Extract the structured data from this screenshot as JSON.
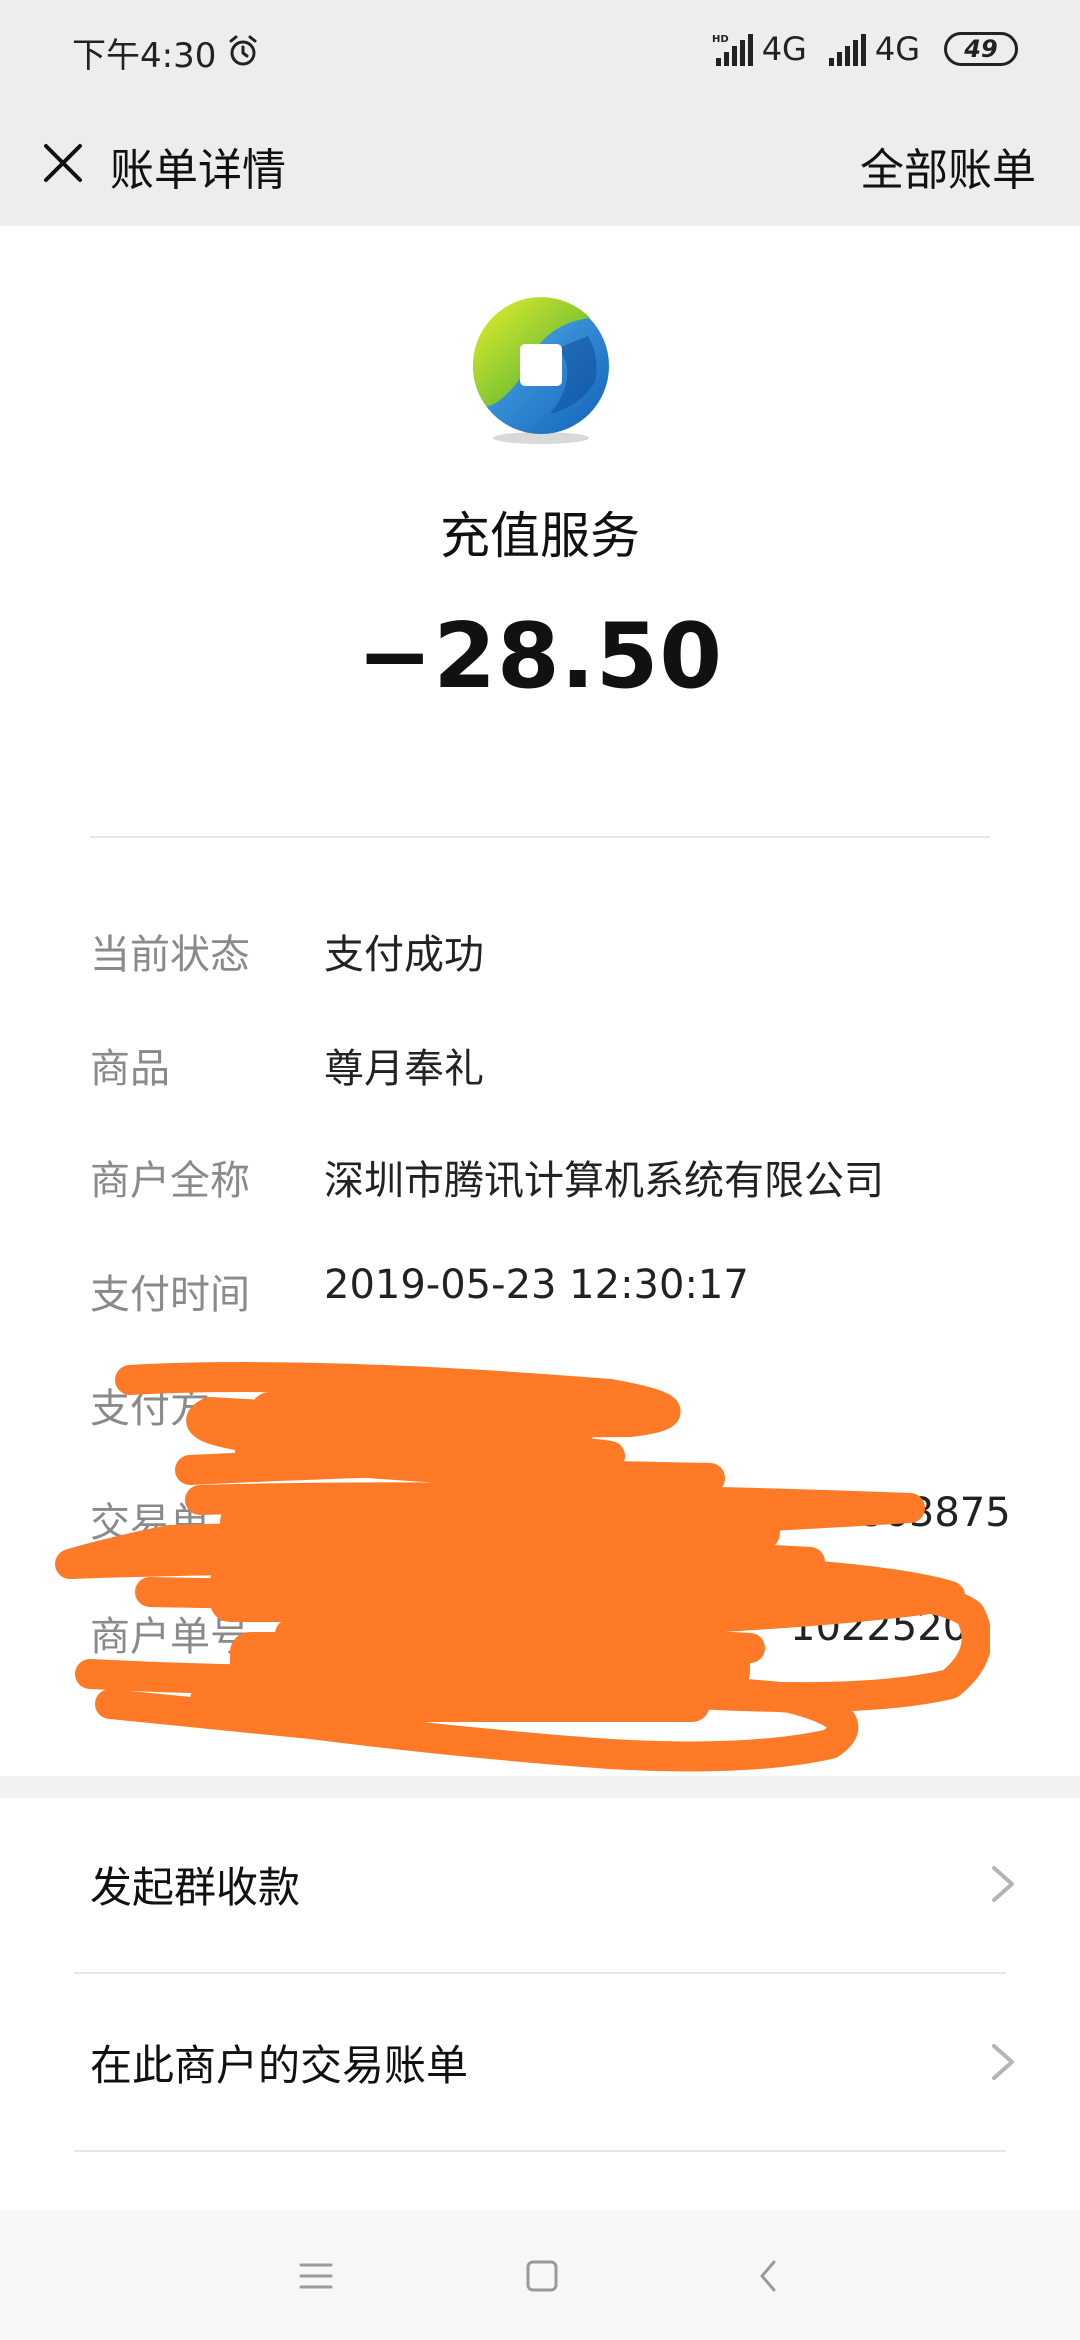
{
  "status_bar": {
    "time": "下午4:30",
    "network_1": "4G",
    "network_2": "4G",
    "battery": "49",
    "icons": [
      "alarm-icon",
      "hd-signal-icon",
      "signal-icon",
      "battery-icon"
    ]
  },
  "header": {
    "title": "账单详情",
    "right_action": "全部账单",
    "close_icon": "close-icon"
  },
  "merchant": {
    "name": "充值服务",
    "amount": "−28.50",
    "logo_icon": "tenpay-logo-icon"
  },
  "details": [
    {
      "label": "当前状态",
      "value": "支付成功"
    },
    {
      "label": "商品",
      "value": "尊月奉礼"
    },
    {
      "label": "商户全称",
      "value": "深圳市腾讯计算机系统有限公司"
    },
    {
      "label": "支付时间",
      "value": "2019-05-23 12:30:17"
    }
  ],
  "redacted_fragments": {
    "row5_label": "支付方",
    "row5_value": ")",
    "row6_label": "交易单",
    "row6_value": "863875",
    "row7_label": "商户单号",
    "row7_value": "1022520"
  },
  "actions": [
    {
      "label": "发起群收款",
      "icon": "chevron-right-icon"
    },
    {
      "label": "在此商户的交易账单",
      "icon": "chevron-right-icon"
    }
  ],
  "system_nav": {
    "icons": [
      "menu-icon",
      "home-icon",
      "back-icon"
    ]
  },
  "colors": {
    "header_bg": "#ededed",
    "label_gray": "#8a8a8a",
    "scribble_orange": "#ff7a26"
  }
}
